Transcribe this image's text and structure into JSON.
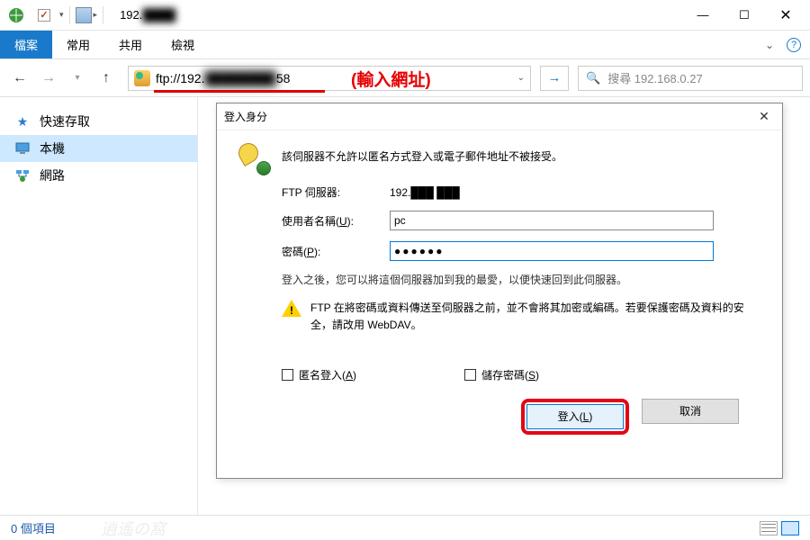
{
  "title": {
    "visible": "192.",
    "obscured": "████"
  },
  "ribbon": {
    "tabs": [
      "檔案",
      "常用",
      "共用",
      "檢視"
    ],
    "active_index": 0
  },
  "nav": {
    "address_prefix": "ftp://192.",
    "address_obscured": "████████",
    "address_suffix": "58",
    "annotation": "(輸入網址)",
    "search_placeholder": "搜尋 192.168.0.27"
  },
  "sidebar": {
    "items": [
      {
        "label": "快速存取",
        "icon": "star",
        "selected": false
      },
      {
        "label": "本機",
        "icon": "monitor",
        "selected": true
      },
      {
        "label": "網路",
        "icon": "network",
        "selected": false
      }
    ]
  },
  "dialog": {
    "title": "登入身分",
    "message": "該伺服器不允許以匿名方式登入或電子郵件地址不被接受。",
    "fields": {
      "server_label": "FTP 伺服器:",
      "server_value_prefix": "192.",
      "server_value_obscured": "███ ███",
      "username_label": "使用者名稱(",
      "username_key": "U",
      "username_label_suffix": "):",
      "username_value": "pc",
      "password_label": "密碼(",
      "password_key": "P",
      "password_label_suffix": "):",
      "password_value": "●●●●●●"
    },
    "hint": "登入之後，您可以將這個伺服器加到我的最愛，以便快速回到此伺服器。",
    "warning": "FTP 在將密碼或資料傳送至伺服器之前，並不會將其加密或編碼。若要保護密碼及資料的安全，請改用 WebDAV。",
    "checks": {
      "anon_label": "匿名登入(",
      "anon_key": "A",
      "anon_suffix": ")",
      "savepw_label": "儲存密碼(",
      "savepw_key": "S",
      "savepw_suffix": ")"
    },
    "buttons": {
      "login": "登入(",
      "login_key": "L",
      "login_suffix": ")",
      "cancel": "取消"
    }
  },
  "status": {
    "text": "0 個項目"
  }
}
